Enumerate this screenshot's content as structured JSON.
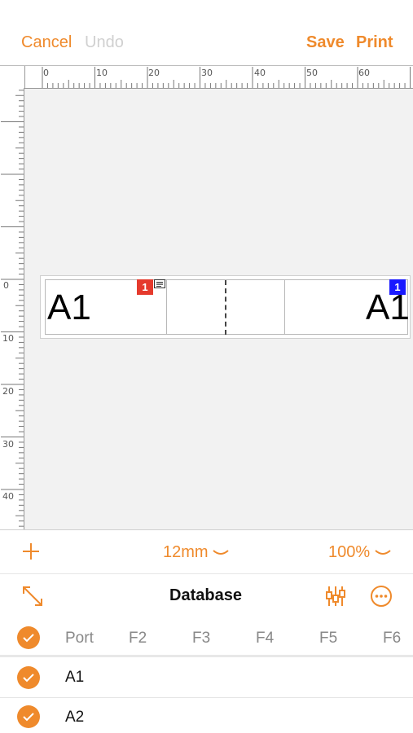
{
  "topbar": {
    "cancel_label": "Cancel",
    "undo_label": "Undo",
    "save_label": "Save",
    "print_label": "Print"
  },
  "ruler": {
    "horizontal_marks": [
      "0",
      "10",
      "20",
      "30",
      "40",
      "50",
      "60"
    ],
    "vertical_marks": [
      "0",
      "10",
      "20",
      "30",
      "40"
    ]
  },
  "label_strip": {
    "left_text": "A1",
    "right_text": "A1",
    "left_badge": "1",
    "right_badge": "1",
    "left_badge_color": "#e53a2d",
    "right_badge_color": "#1a1aff"
  },
  "toolbar": {
    "add_icon": "plus-icon",
    "tape_width": "12mm",
    "zoom": "100%"
  },
  "database": {
    "title": "Database",
    "expand_icon": "expand-arrows-icon",
    "columns_icon": "column-settings-icon",
    "more_icon": "more-icon",
    "headers": [
      "Port",
      "F2",
      "F3",
      "F4",
      "F5",
      "F6"
    ],
    "rows": [
      "A1",
      "A2"
    ]
  },
  "colors": {
    "accent": "#ef8a2c"
  }
}
